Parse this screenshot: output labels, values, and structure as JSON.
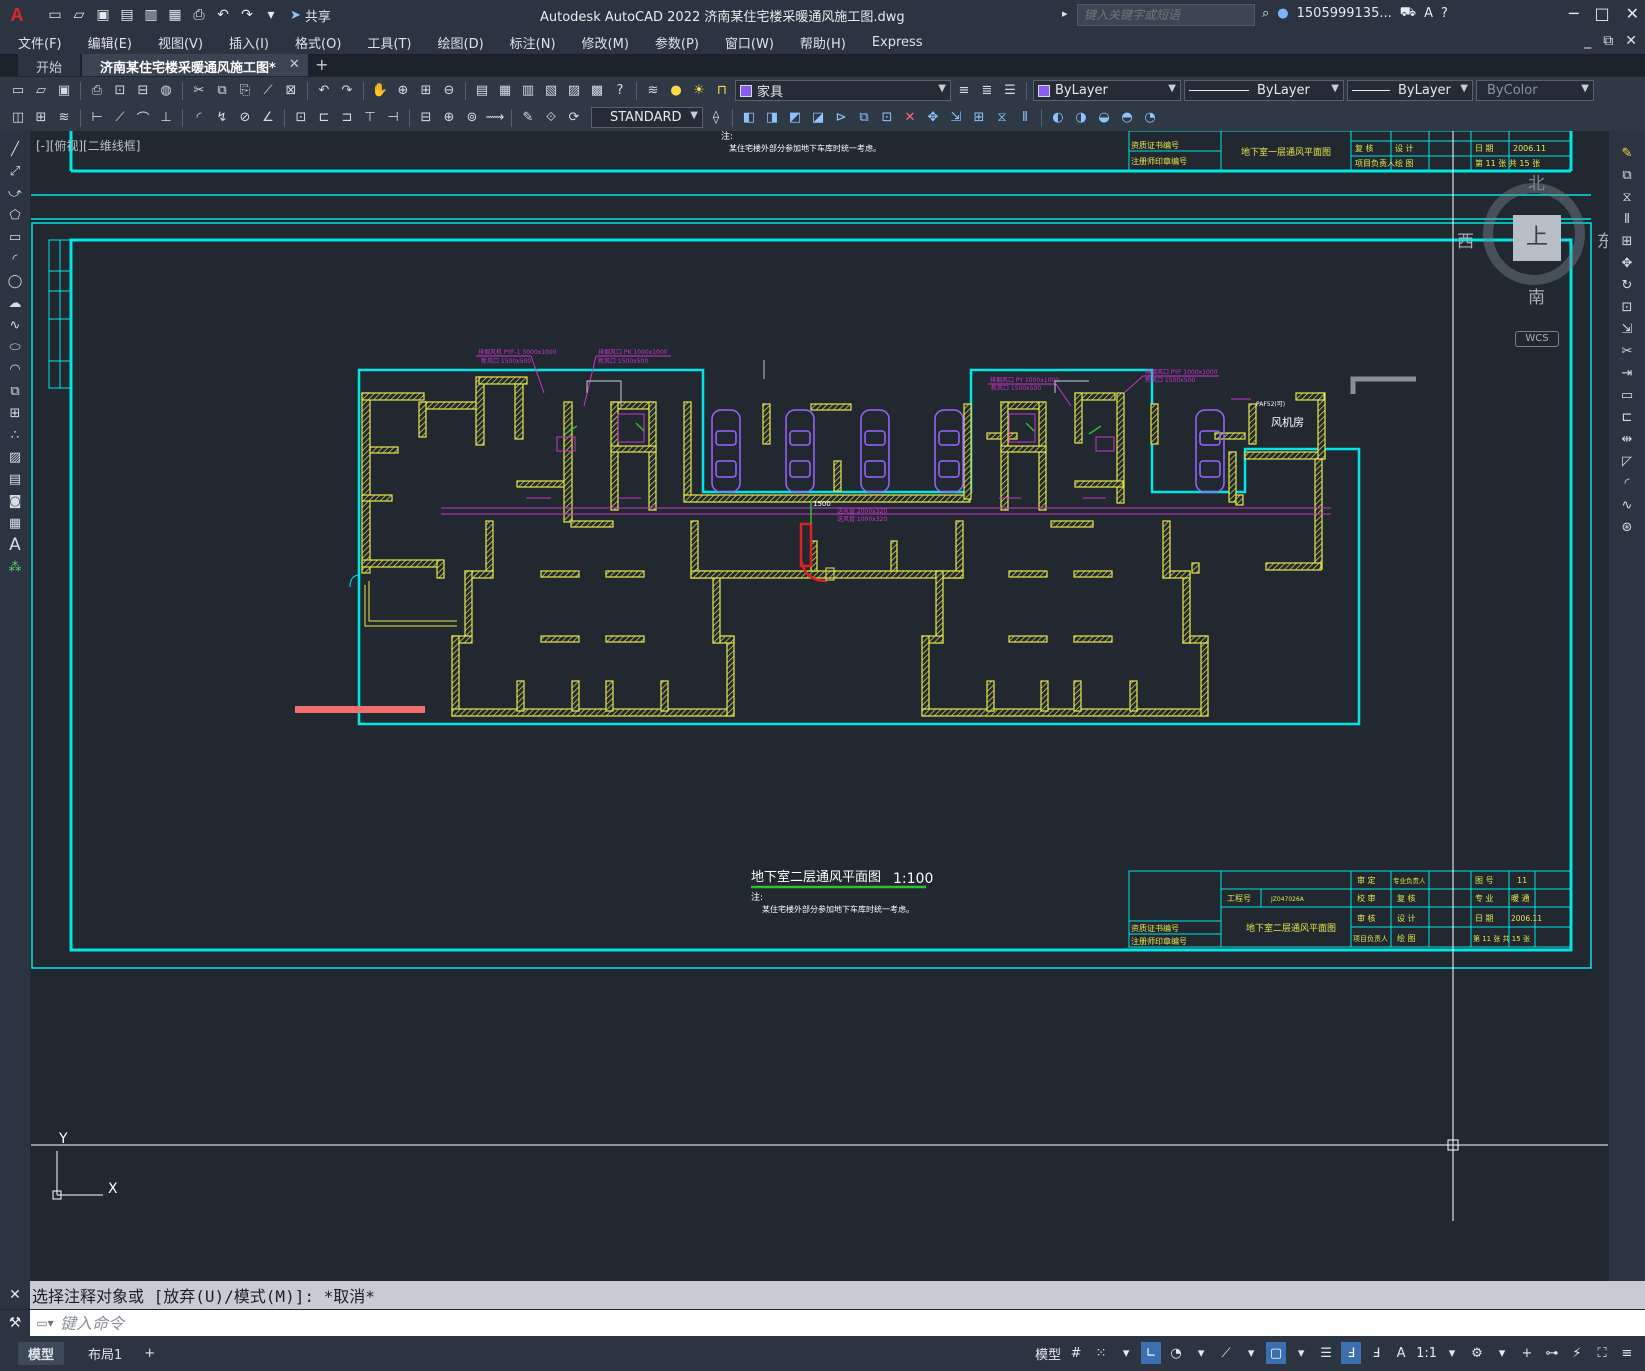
{
  "titlebar": {
    "app_logo": "A",
    "share_label": "共享",
    "title": "Autodesk AutoCAD 2022    济南某住宅楼采暖通风施工图.dwg",
    "search_placeholder": "键入关键字或短语",
    "user": "1505999135...",
    "minimize": "─",
    "maximize": "□",
    "close": "✕"
  },
  "menu": {
    "items": [
      "文件(F)",
      "编辑(E)",
      "视图(V)",
      "插入(I)",
      "格式(O)",
      "工具(T)",
      "绘图(D)",
      "标注(N)",
      "修改(M)",
      "参数(P)",
      "窗口(W)",
      "帮助(H)",
      "Express"
    ]
  },
  "tabs": {
    "start": "开始",
    "active": "济南某住宅楼采暖通风施工图*",
    "close": "✕",
    "add": "+"
  },
  "toolbar": {
    "layer": "家具",
    "color": "ByLayer",
    "linetype": "ByLayer",
    "lineweight": "ByLayer",
    "plotstyle": "ByColor",
    "textstyle": "STANDARD"
  },
  "canvas": {
    "view_label": "[-][俯视][二维线框]",
    "axis_x": "X",
    "axis_y": "Y"
  },
  "viewcube": {
    "face": "上",
    "north": "北",
    "south": "南",
    "east": "东",
    "west": "西",
    "wcs": "WCS"
  },
  "drawing": {
    "title": "地下室二层通风平面图",
    "scale": "1:100",
    "note_label": "注:",
    "note_text": "某住宅楼外部分参加地下车库时统一考虑。",
    "room_label": "风机房",
    "room_small_label": "PAF52(可)",
    "titleblock": {
      "drawing_name": "地下室二层通风平面图",
      "top_drawing_name": "地下室一层通风平面图",
      "left_row1": "资质证书编号",
      "left_row2": "注册师印章编号",
      "project_no_label": "工程号",
      "project_no": "JZ047026A",
      "review_label": "审 定",
      "check_label": "校 审",
      "audit_label": "审 核",
      "leader_label": "项目负责人",
      "pro_leader_label": "专业负责人",
      "verify_label": "复 核",
      "design_label": "设 计",
      "draw_label": "绘 图",
      "fig_no_label": "图 号",
      "fig_no": "11",
      "major_label": "专 业",
      "major": "暖 通",
      "date_label": "日 期",
      "date": "2006.11",
      "sheet": "第 11 张 共 15 张"
    }
  },
  "command": {
    "history": "选择注释对象或 [放弃(U)/模式(M)]: *取消*",
    "placeholder": "键入命令"
  },
  "status": {
    "tab_model": "模型",
    "tab_layout1": "布局1",
    "add": "+",
    "model_label": "模型",
    "scale": "1:1"
  },
  "colors": {
    "frame": "#00e5e5",
    "wall": "#e6e64d",
    "duct": "#cc33cc",
    "car": "#9966ff",
    "highlight": "#f07070",
    "equipment_red": "#e02020"
  }
}
